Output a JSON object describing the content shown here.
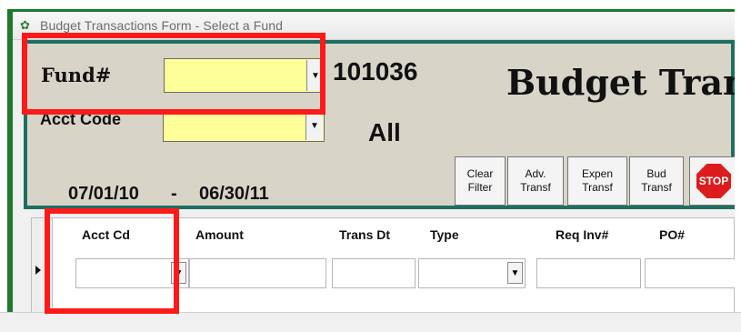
{
  "window": {
    "title": "Budget Transactions Form - Select a Fund"
  },
  "header": {
    "fund_label": "Fund#",
    "fund_value": "",
    "fund_number": "101036",
    "app_title": "Budget Tran",
    "acct_label": "Acct Code",
    "acct_value": "",
    "all_text": "All",
    "date_start": "07/01/10",
    "date_dash": "-",
    "date_end": "06/30/11",
    "buttons": [
      {
        "label": "Clear\nFilter"
      },
      {
        "label": "Adv.\nTransf"
      },
      {
        "label": "Expen\nTransf"
      },
      {
        "label": "Bud\nTransf"
      }
    ],
    "stop_label": "STOP"
  },
  "grid": {
    "columns": [
      "Acct Cd",
      "Amount",
      "Trans Dt",
      "Type",
      "Req Inv#",
      "PO#"
    ],
    "row": [
      "",
      "",
      "",
      "",
      "",
      ""
    ]
  },
  "colors": {
    "accent_green": "#1d7a2c",
    "accent_teal": "#1d6f61",
    "highlight_red": "#ff1a1a",
    "input_yellow": "#ffff99",
    "stop_red": "#dd1d1d"
  },
  "icons": {
    "title_icon": "app-icon",
    "dropdown_icon": "chevron-down-icon",
    "stop_icon": "stop-icon"
  }
}
